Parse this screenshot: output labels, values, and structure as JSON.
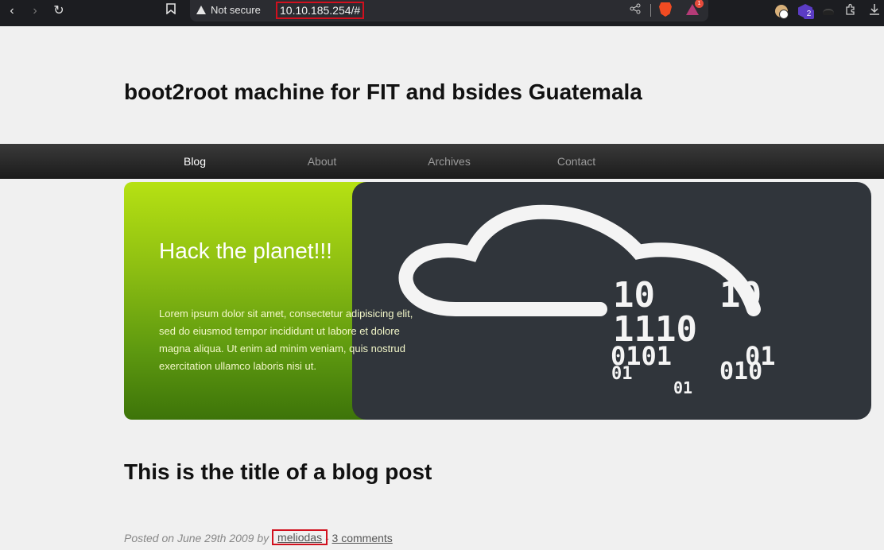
{
  "browser": {
    "security_label": "Not secure",
    "url": "10.10.185.254/#",
    "rewards_count": "1",
    "extension_badge": "2"
  },
  "site": {
    "title": "boot2root machine for FIT and bsides Guatemala"
  },
  "nav": {
    "items": [
      {
        "label": "Blog",
        "active": true
      },
      {
        "label": "About",
        "active": false
      },
      {
        "label": "Archives",
        "active": false
      },
      {
        "label": "Contact",
        "active": false
      }
    ]
  },
  "hero": {
    "title": "Hack the planet!!!",
    "text": "Lorem ipsum dolor sit amet, consectetur adipisicing elit, sed do eiusmod tempor incididunt ut labore et dolore magna aliqua. Ut enim ad minim veniam, quis nostrud exercitation ullamco laboris nisi ut.",
    "binary_rows": [
      "10",
      "10",
      "1110",
      "0101",
      "01",
      "01",
      "010",
      "01"
    ],
    "colors": {
      "green_top": "#b6e113",
      "green_bottom": "#3d7409",
      "panel": "#30353b"
    }
  },
  "post": {
    "title": "This is the title of a blog post",
    "posted_prefix": "Posted on June 29th 2009 by",
    "author": "meliodas",
    "separator": "-",
    "comments": "3 comments"
  }
}
